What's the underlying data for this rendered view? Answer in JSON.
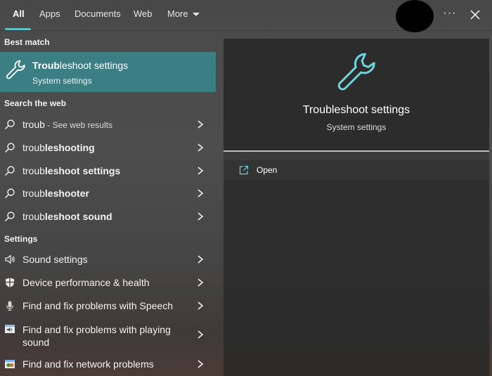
{
  "tabs": [
    {
      "label": "All",
      "active": true
    },
    {
      "label": "Apps"
    },
    {
      "label": "Documents"
    },
    {
      "label": "Web"
    },
    {
      "label": "More"
    }
  ],
  "header": {
    "more_options_label": "···"
  },
  "colors": {
    "accent": "#5fc1c8",
    "best_match_bg": "#3b7e84"
  },
  "best_match": {
    "section_title": "Best match",
    "icon": "wrench-icon",
    "title_bold": "Troub",
    "title_rest": "leshoot settings",
    "subtitle": "System settings"
  },
  "web": {
    "section_title": "Search the web",
    "items": [
      {
        "bold": "troub",
        "rest": "",
        "hint": " - See web results"
      },
      {
        "bold": "troub",
        "rest": "leshooting",
        "hint": ""
      },
      {
        "bold": "troub",
        "rest": "leshoot settings",
        "hint": ""
      },
      {
        "bold": "troub",
        "rest": "leshooter",
        "hint": ""
      },
      {
        "bold": "troub",
        "rest": "leshoot sound",
        "hint": ""
      }
    ]
  },
  "settings": {
    "section_title": "Settings",
    "items": [
      {
        "label": "Sound settings",
        "icon": "speaker-icon"
      },
      {
        "label": "Device performance & health",
        "icon": "shield-icon"
      },
      {
        "label": "Find and fix problems with Speech",
        "icon": "microphone-icon"
      },
      {
        "label": "Find and fix problems with playing sound",
        "icon": "audio-troubleshooter-icon"
      },
      {
        "label": "Find and fix network problems",
        "icon": "network-troubleshooter-icon"
      }
    ]
  },
  "preview": {
    "icon": "wrench-icon",
    "title": "Troubleshoot settings",
    "subtitle": "System settings",
    "actions": [
      {
        "label": "Open",
        "icon": "open-external-icon"
      }
    ]
  }
}
